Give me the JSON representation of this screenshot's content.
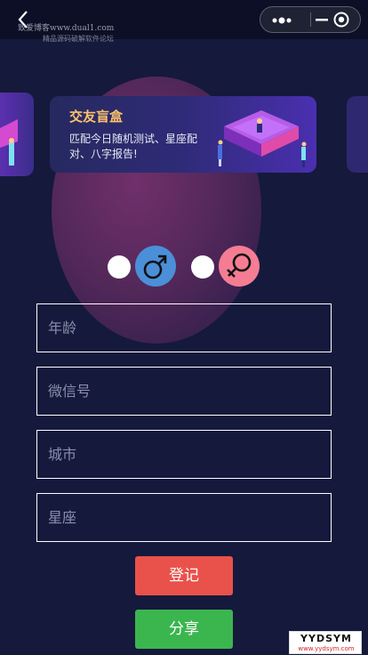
{
  "watermark": {
    "line1": "致爱博客www.dual1.com",
    "line2": "精品源码破解软件论坛"
  },
  "banner": {
    "title": "交友盲盒",
    "description": "匹配今日随机测试、星座配对、八字报告!"
  },
  "gender": {
    "male_symbol": "♂",
    "female_symbol": "♀"
  },
  "form": {
    "age_placeholder": "年龄",
    "wechat_placeholder": "微信号",
    "city_placeholder": "城市",
    "constellation_placeholder": "星座"
  },
  "buttons": {
    "login": "登记",
    "share": "分享"
  },
  "badge": {
    "title": "YYDSYM",
    "url": "www.yydsym.com"
  },
  "colors": {
    "background": "#151a3d",
    "banner_title": "#ffc26b",
    "male": "#4a8fd8",
    "female": "#f47c93",
    "login_button": "#e8524a",
    "share_button": "#3bb64f"
  }
}
